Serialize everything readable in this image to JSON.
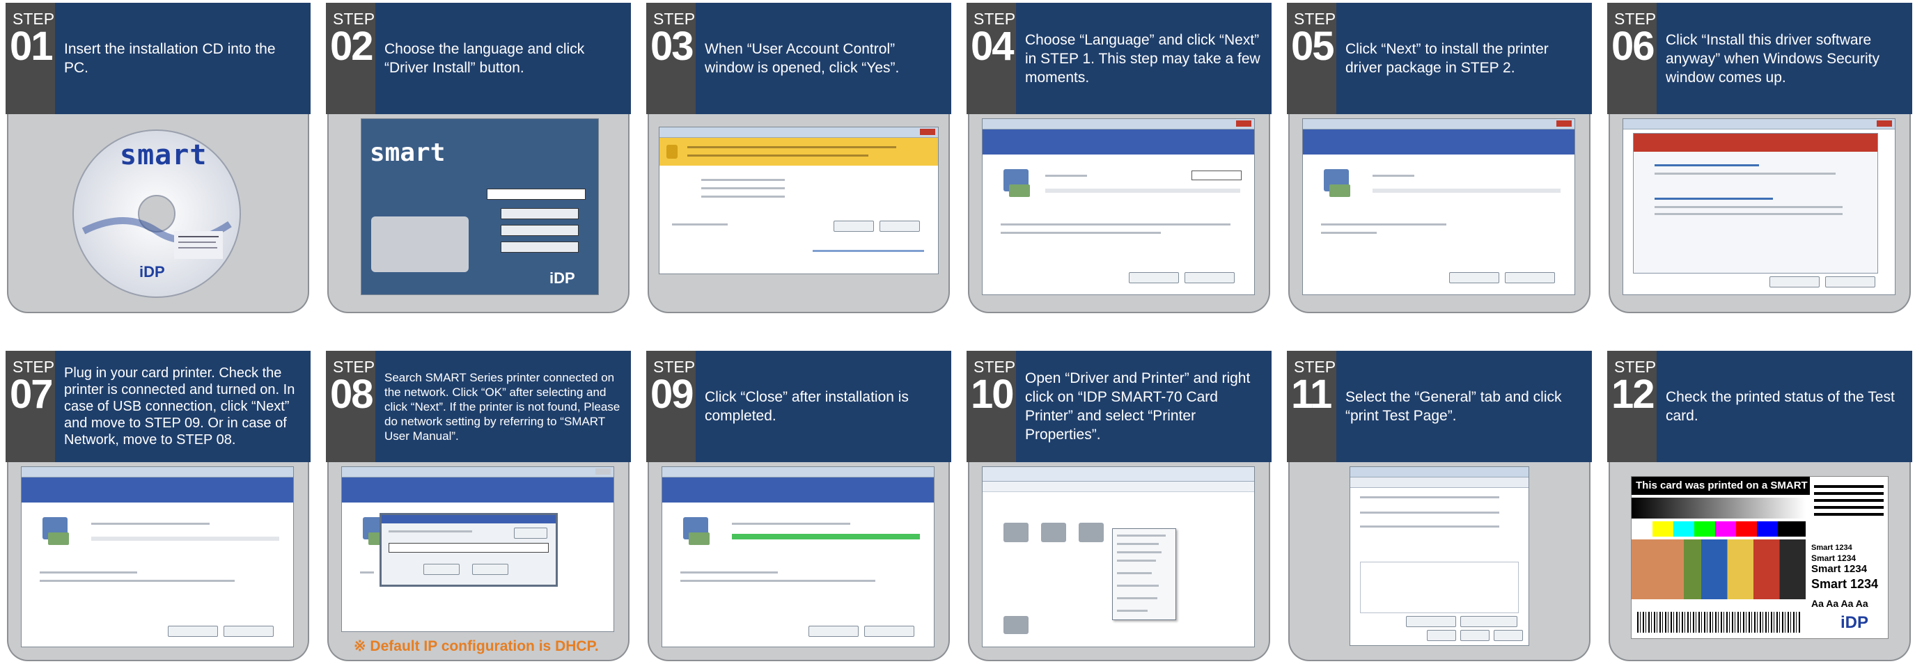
{
  "steps": [
    {
      "word": "STEP",
      "num": "01",
      "text": "Insert the installation CD into the PC."
    },
    {
      "word": "STEP",
      "num": "02",
      "text": "Choose the language and click “Driver Install” button."
    },
    {
      "word": "STEP",
      "num": "03",
      "text": "When “User Account Control” window is opened, click “Yes”."
    },
    {
      "word": "STEP",
      "num": "04",
      "text": "Choose “Language” and click “Next” in STEP 1. This step may take a few moments."
    },
    {
      "word": "STEP",
      "num": "05",
      "text": "Click “Next” to install the printer driver package in STEP 2."
    },
    {
      "word": "STEP",
      "num": "06",
      "text": "Click “Install this driver software anyway” when Windows Security window comes up."
    },
    {
      "word": "STEP",
      "num": "07",
      "text": "Plug in your card printer. Check the printer is connected and turned on. In case of USB connection, click “Next” and move to STEP 09. Or in case of Network, move to STEP 08."
    },
    {
      "word": "STEP",
      "num": "08",
      "text": "Search SMART Series printer connected on the network. Click “OK” after selecting and click “Next”. If the printer is not found, Please do network setting by referring to “SMART User Manual”."
    },
    {
      "word": "STEP",
      "num": "09",
      "text": "Click “Close” after installation is completed."
    },
    {
      "word": "STEP",
      "num": "10",
      "text": "Open “Driver and Printer” and right click on “IDP SMART-70 Card Printer” and select “Printer Properties”."
    },
    {
      "word": "STEP",
      "num": "11",
      "text": "Select the “General” tab and click “print Test Page”."
    },
    {
      "word": "STEP",
      "num": "12",
      "text": "Check the printed status of the Test card."
    }
  ],
  "footnote": "※  Default IP configuration is DHCP.",
  "cd": {
    "logo": "smart",
    "brand": "iDP"
  },
  "installer": {
    "logo": "smart",
    "brand": "iDP"
  },
  "test_card": {
    "headline": "This card was printed on a SMART",
    "lines": [
      "Smart 1234",
      "Smart 1234",
      "Smart 1234",
      "Smart 1234"
    ],
    "sample": "Aa  Aa  Aa  Aa",
    "brand": "iDP"
  },
  "colors": {
    "header": "#1f3f6b",
    "step_tab": "#4a4a4a",
    "note": "#e67e22"
  }
}
